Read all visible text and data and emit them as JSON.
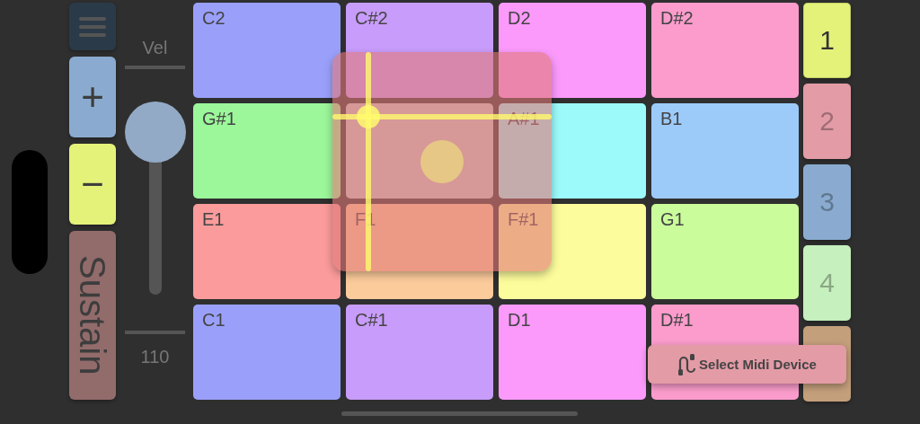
{
  "side_buttons": [
    {
      "kind": "menu",
      "color": "#2b3a48"
    },
    {
      "kind": "text",
      "label": "+",
      "color": "#8aabcf"
    },
    {
      "kind": "text",
      "label": "−",
      "color": "#e4f27a"
    },
    {
      "kind": "vertical",
      "label": "Sustain",
      "color": "#926b6b"
    }
  ],
  "velocity": {
    "label": "Vel",
    "value": "110",
    "level": 0.84
  },
  "pads": [
    {
      "kind": "note",
      "label": "C2",
      "color": "#9aa0fa"
    },
    {
      "kind": "note",
      "label": "C#2",
      "color": "#c89cfa"
    },
    {
      "kind": "note",
      "label": "D2",
      "color": "#fb9afb"
    },
    {
      "kind": "note",
      "label": "D#2",
      "color": "#fb9ccc"
    },
    {
      "kind": "note",
      "label": "G#1",
      "color": "#9bf79a"
    },
    {
      "kind": "covered"
    },
    {
      "kind": "note",
      "label": "A#1",
      "color": "#9cfafa"
    },
    {
      "kind": "note",
      "label": "B1",
      "color": "#9ccbfa"
    },
    {
      "kind": "note",
      "label": "E1",
      "color": "#fb9b9b"
    },
    {
      "kind": "note",
      "label": "F1",
      "color": "#fccb9c"
    },
    {
      "kind": "note",
      "label": "F#1",
      "color": "#fcfc9c"
    },
    {
      "kind": "note",
      "label": "G1",
      "color": "#cbfc9c"
    },
    {
      "kind": "note",
      "label": "C1",
      "color": "#9aa0fa"
    },
    {
      "kind": "note",
      "label": "C#1",
      "color": "#c89cfa"
    },
    {
      "kind": "note",
      "label": "D1",
      "color": "#fb9afb"
    },
    {
      "kind": "note",
      "label": "D#1",
      "color": "#fb9ccc"
    }
  ],
  "channels": [
    {
      "label": "1",
      "selected": true,
      "color": "#e4f27a"
    },
    {
      "label": "2",
      "selected": false,
      "color": "#e39ba6"
    },
    {
      "label": "3",
      "selected": false,
      "color": "#8aabcf"
    },
    {
      "label": "4",
      "selected": false,
      "color": "#c6f0bd"
    },
    {
      "selected": false,
      "color": "#c49f7c"
    }
  ],
  "midi_button": {
    "label": "Select Midi Device"
  }
}
